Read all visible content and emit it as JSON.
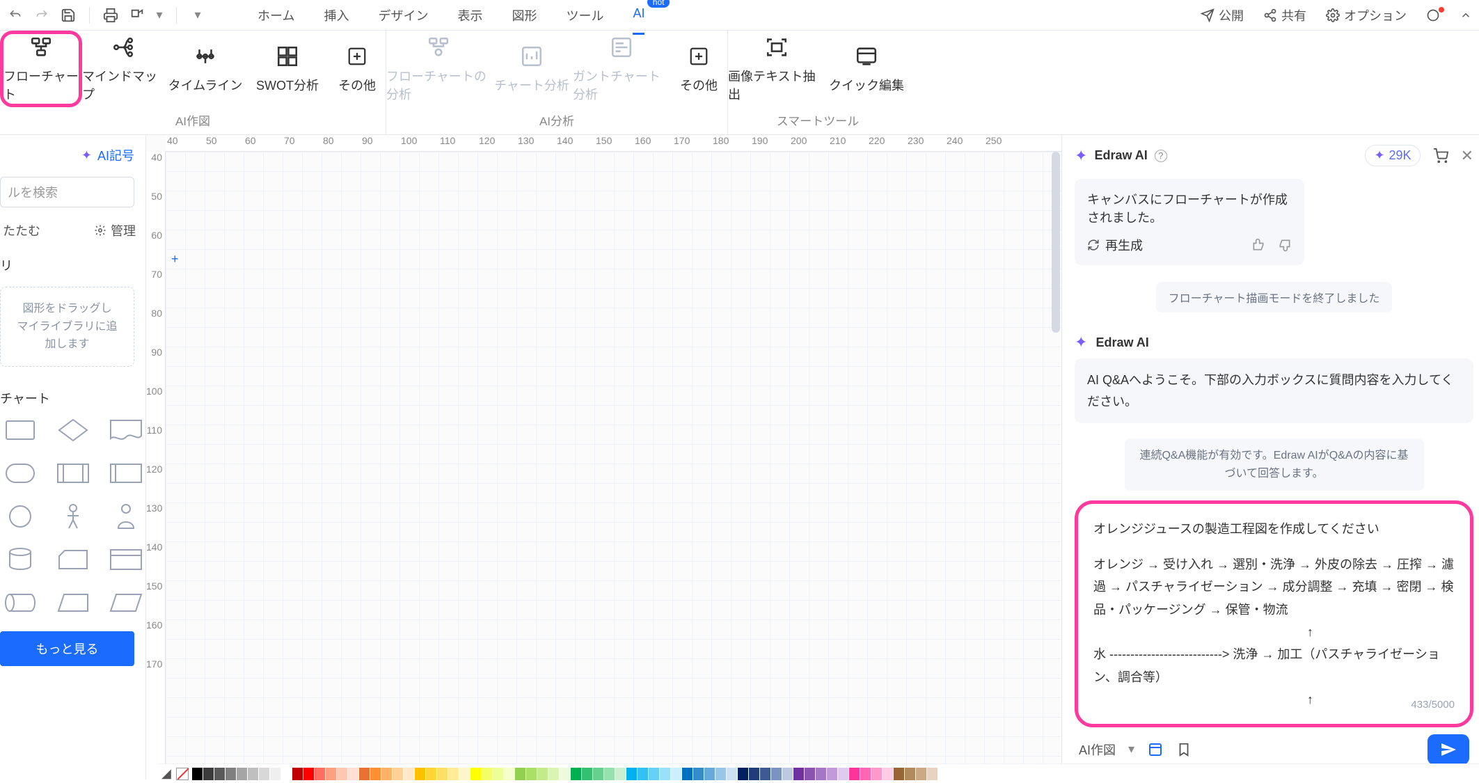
{
  "menu": {
    "home": "ホーム",
    "insert": "挿入",
    "design": "デザイン",
    "display": "表示",
    "shapes": "図形",
    "tools": "ツール",
    "ai": "AI",
    "hot": "hot"
  },
  "top_right": {
    "publish": "公開",
    "share": "共有",
    "options": "オプション"
  },
  "ribbon": {
    "group1_label": "AI作図",
    "group2_label": "AI分析",
    "group3_label": "スマートツール",
    "flowchart": "フローチャート",
    "mindmap": "マインドマップ",
    "timeline": "タイムライン",
    "swot": "SWOT分析",
    "other1": "その他",
    "flow_analysis": "フローチャートの分析",
    "chart_analysis": "チャート分析",
    "gantt_analysis": "ガントチャート分析",
    "other2": "その他",
    "ocr": "画像テキスト抽出",
    "quick_edit": "クイック編集"
  },
  "sidebar": {
    "ai_symbol": "AI記号",
    "search_placeholder": "ルを検索",
    "fold": "たたむ",
    "manage": "管理",
    "ri": "リ",
    "drop_hint": "図形をドラッグし\nマイライブラリに追\n加します",
    "chart_heading": "チャート",
    "more": "もっと見る"
  },
  "ruler_h": [
    "40",
    "50",
    "60",
    "70",
    "80",
    "90",
    "100",
    "110",
    "120",
    "130",
    "140",
    "150",
    "160",
    "170",
    "180",
    "190",
    "200",
    "210",
    "220",
    "230",
    "240",
    "250"
  ],
  "ruler_v": [
    "40",
    "50",
    "60",
    "70",
    "80",
    "90",
    "100",
    "110",
    "120",
    "130",
    "140",
    "150",
    "160",
    "170"
  ],
  "ai": {
    "title": "Edraw AI",
    "tokens": "29K",
    "created_msg": "キャンバスにフローチャートが作成されました。",
    "regenerate": "再生成",
    "mode_exit": "フローチャート描画モードを終了しました",
    "ai_name": "Edraw AI",
    "welcome": "AI Q&Aへようこそ。下部の入力ボックスに質問内容を入力してください。",
    "qa_notice": "連続Q&A機能が有効です。Edraw AIがQ&Aの内容に基づいて回答します。",
    "input_line1": "オレンジジュースの製造工程図を作成してください",
    "input_line2": "オレンジ → 受け入れ → 選別・洗浄 → 外皮の除去 → 圧搾 → 濾過 → パスチャライゼーション → 成分調整 → 充填 → 密閉 → 検品・パッケージング → 保管・物流",
    "input_up1": "↑",
    "input_line3": "水 ---------------------------> 洗浄 → 加工（パスチャライゼーション、調合等）",
    "input_up2": "↑",
    "counter": "433/5000",
    "mode_label": "AI作図"
  },
  "colors": [
    "#000000",
    "#3b3b3b",
    "#595959",
    "#7f7f7f",
    "#a5a5a5",
    "#bfbfbf",
    "#d8d8d8",
    "#efefef",
    "#ffffff",
    "#c00000",
    "#ff0000",
    "#ff6f61",
    "#ff9e80",
    "#ffc7b3",
    "#ffe0d6",
    "#e97132",
    "#ff8f33",
    "#ffb266",
    "#ffd199",
    "#ffe8cc",
    "#ffc000",
    "#ffd633",
    "#ffe066",
    "#ffeb99",
    "#fff5cc",
    "#ffff00",
    "#f2ff66",
    "#ecff99",
    "#f5ffcc",
    "#92d050",
    "#a9e066",
    "#c1eb8c",
    "#d8f5b3",
    "#eefadd",
    "#00b050",
    "#33c06f",
    "#66d08f",
    "#99e0af",
    "#ccefd0",
    "#00b0f0",
    "#33c1f3",
    "#66d1f6",
    "#99e1f9",
    "#ccf0fc",
    "#0070c0",
    "#338dcd",
    "#66a9da",
    "#99c6e6",
    "#cce2f3",
    "#002060",
    "#1f3d7a",
    "#3d5a94",
    "#7a94bf",
    "#bccadf",
    "#7030a0",
    "#8b52b3",
    "#a775c6",
    "#c399d9",
    "#deccec",
    "#ff3399",
    "#ff66b3",
    "#ff99cc",
    "#ffcce6",
    "#996633",
    "#b38a5c",
    "#cca885",
    "#e6d3c2"
  ]
}
